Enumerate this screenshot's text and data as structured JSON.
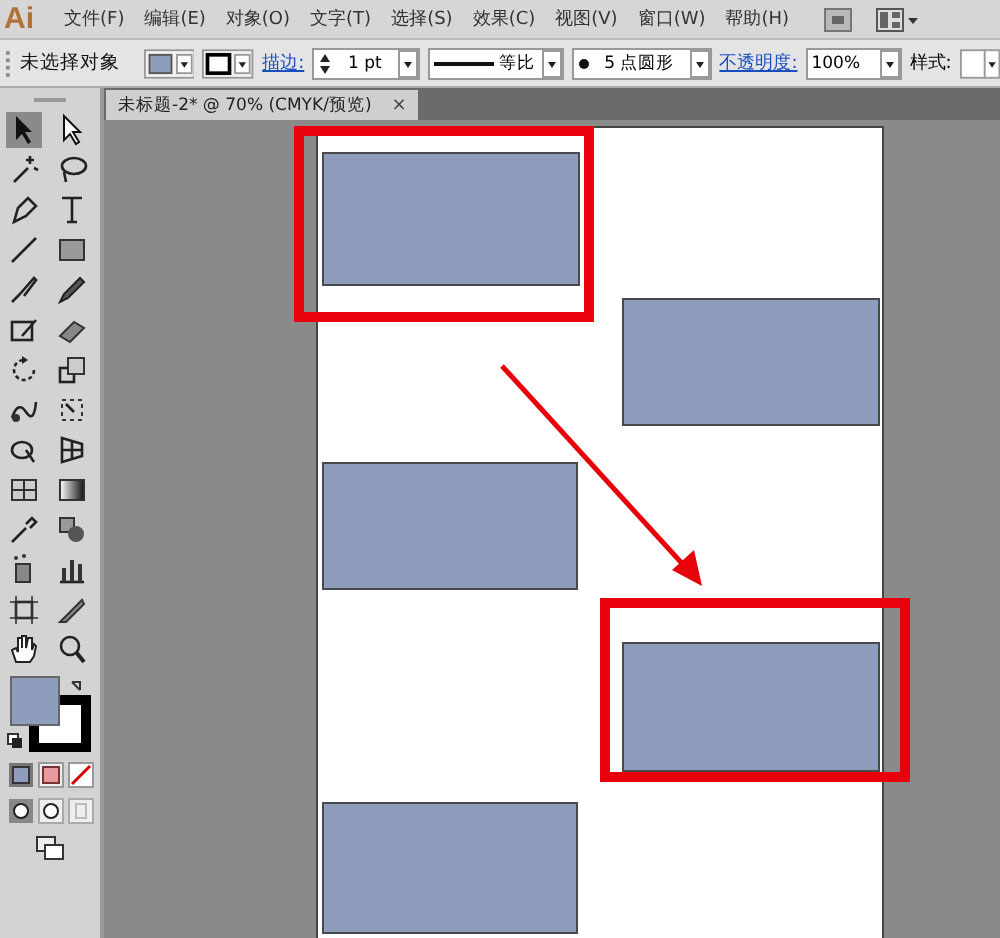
{
  "app": {
    "logo": "Ai"
  },
  "menu": [
    "文件(F)",
    "编辑(E)",
    "对象(O)",
    "文字(T)",
    "选择(S)",
    "效果(C)",
    "视图(V)",
    "窗口(W)",
    "帮助(H)"
  ],
  "control_bar": {
    "selection": "未选择对象",
    "stroke_label": "描边:",
    "stroke_weight": "1 pt",
    "profile": "等比",
    "brush": "5 点圆形",
    "opacity_label": "不透明度:",
    "opacity": "100%",
    "style_label": "样式:"
  },
  "document_tab": {
    "title": "未标题-2* @ 70% (CMYK/预览)",
    "close": "×"
  }
}
